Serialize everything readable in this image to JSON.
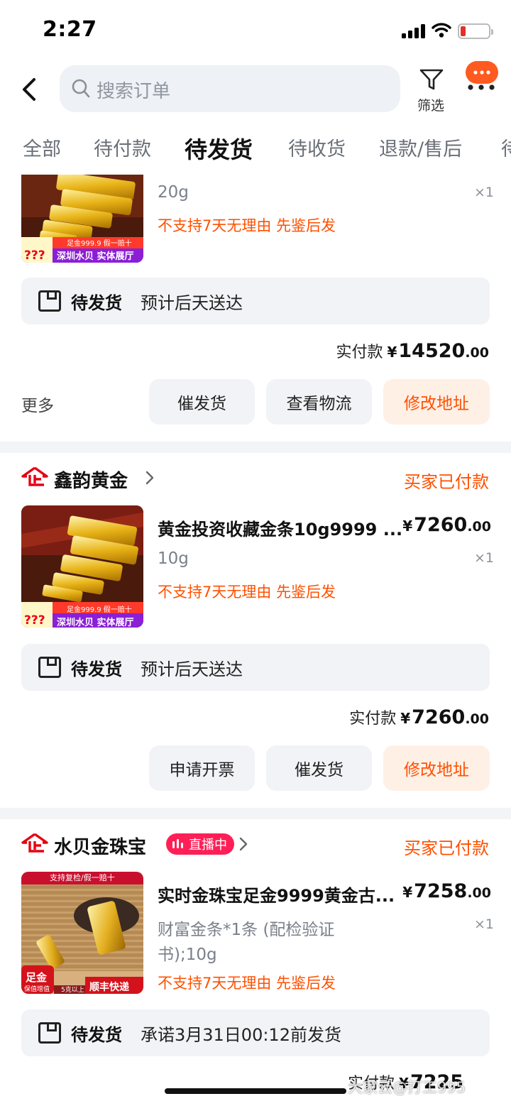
{
  "status_bar": {
    "time": "2:27"
  },
  "header": {
    "search_placeholder": "搜索订单",
    "filter_label": "筛选"
  },
  "tabs": [
    {
      "label": "全部"
    },
    {
      "label": "待付款"
    },
    {
      "label": "待发货",
      "active": true
    },
    {
      "label": "待收货"
    },
    {
      "label": "退款/售后"
    },
    {
      "label": "待"
    }
  ],
  "orders": [
    {
      "spec": "20g",
      "qty": "×1",
      "tags": "不支持7天无理由  先鉴后发",
      "ship_status": "待发货",
      "ship_eta": "预计后天送达",
      "paid_label": "实付款",
      "paid_currency": "¥",
      "paid_int": "14520",
      "paid_dec": ".00",
      "buttons": {
        "more": "更多",
        "urge": "催发货",
        "logistics": "查看物流",
        "address": "修改地址"
      },
      "thumb": {
        "price_mark": "???",
        "banner_top": "足金999.9 假一赔十",
        "banner_bottom": "深圳水贝 实体展厅"
      }
    },
    {
      "shop_name": "鑫韵黄金",
      "shop_status": "买家已付款",
      "title": "黄金投资收藏金条10g9999 ...",
      "price_currency": "¥",
      "price_int": "7260",
      "price_dec": ".00",
      "spec": "10g",
      "qty": "×1",
      "tags": "不支持7天无理由  先鉴后发",
      "ship_status": "待发货",
      "ship_eta": "预计后天送达",
      "paid_label": "实付款",
      "paid_currency": "¥",
      "paid_int": "7260",
      "paid_dec": ".00",
      "buttons": {
        "invoice": "申请开票",
        "urge": "催发货",
        "address": "修改地址"
      },
      "thumb": {
        "price_mark": "???",
        "banner_top": "足金999.9 假一赔十",
        "banner_bottom": "深圳水贝 实体展厅"
      }
    },
    {
      "shop_name": "水贝金珠宝",
      "live_badge": "直播中",
      "shop_status": "买家已付款",
      "title": "实时金珠宝足金9999黄金古...",
      "price_currency": "¥",
      "price_int": "7258",
      "price_dec": ".00",
      "spec_line1": "财富金条*1条 (配检验证",
      "spec_line2": "书);10g",
      "qty": "×1",
      "tags": "不支持7天无理由  先鉴后发",
      "ship_status": "待发货",
      "ship_eta": "承诺3月31日00:12前发货",
      "paid_label": "实付款",
      "paid_currency": "¥",
      "paid_partial": "7225",
      "thumb": {
        "banner_top": "支持复检/假一赔十",
        "badge": "足金",
        "badge_sub": "保值增值",
        "express": "顺丰快递",
        "express_pre": "5克以上"
      }
    }
  ],
  "watermark": "大家云@打工995",
  "colors": {
    "accent": "#ff5000",
    "brand_red": "#e60012",
    "live": "#ff1f56"
  }
}
